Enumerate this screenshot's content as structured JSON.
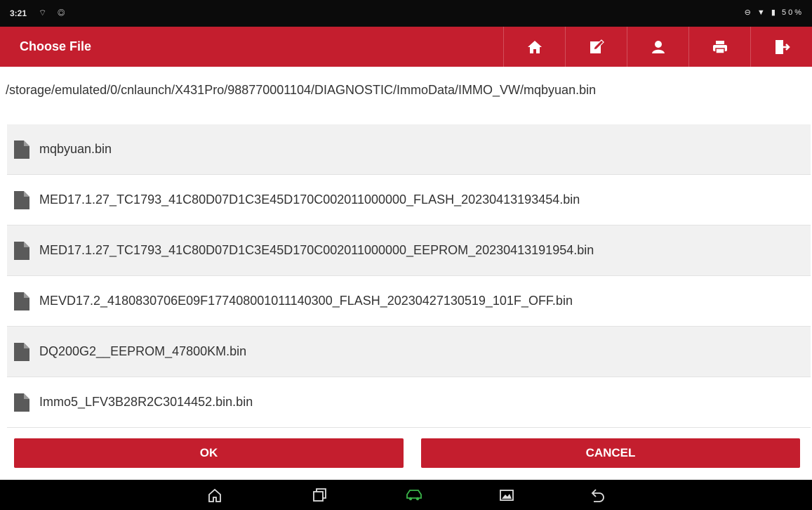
{
  "status_bar": {
    "time": "3:21",
    "left_icons": "⌔ ◎",
    "right_icons": "⊖ ▼ ▮",
    "battery": "50%"
  },
  "header": {
    "title": "Choose File",
    "toolbar_icons": [
      "home-icon",
      "edit-icon",
      "user-icon",
      "print-icon",
      "exit-icon"
    ]
  },
  "path": "/storage/emulated/0/cnlaunch/X431Pro/988770001104/DIAGNOSTIC/ImmoData/IMMO_VW/mqbyuan.bin",
  "files": [
    {
      "name": "mqbyuan.bin"
    },
    {
      "name": "MED17.1.27_TC1793_41C80D07D1C3E45D170C002011000000_FLASH_20230413193454.bin"
    },
    {
      "name": "MED17.1.27_TC1793_41C80D07D1C3E45D170C002011000000_EEPROM_20230413191954.bin"
    },
    {
      "name": "MEVD17.2_4180830706E09F177408001011140300_FLASH_20230427130519_101F_OFF.bin"
    },
    {
      "name": "DQ200G2__EEPROM_47800KM.bin"
    },
    {
      "name": "Immo5_LFV3B28R2C3014452.bin.bin"
    }
  ],
  "buttons": {
    "ok": "OK",
    "cancel": "CANCEL"
  },
  "nav_bar": [
    "home-icon",
    "recent-apps-icon",
    "car-diagnostic-icon",
    "screenshot-icon",
    "back-icon"
  ],
  "colors": {
    "accent": "#c41e2e",
    "status_bar": "#0b0b0b",
    "row_alt": "#f1f1f1",
    "nav_bar": "#000000",
    "nav_active": "#3bb54a"
  }
}
